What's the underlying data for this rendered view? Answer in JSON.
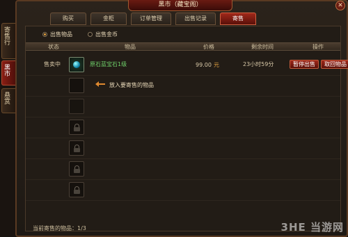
{
  "window": {
    "title": "黑市（藏宝阁）",
    "close_label": "✕"
  },
  "side_tabs": [
    {
      "label": "寄售行",
      "active": false
    },
    {
      "label": "黑市",
      "active": true
    },
    {
      "label": "悬赏",
      "active": false
    }
  ],
  "tabs": [
    {
      "label": "购买",
      "active": false
    },
    {
      "label": "金柜",
      "active": false
    },
    {
      "label": "订单管理",
      "active": false
    },
    {
      "label": "出售记录",
      "active": false
    },
    {
      "label": "寄售",
      "active": true
    }
  ],
  "sell_type": {
    "options": [
      {
        "label": "出售物品",
        "selected": true
      },
      {
        "label": "出售金币",
        "selected": false
      }
    ]
  },
  "table": {
    "headers": [
      "状态",
      "物品",
      "价格",
      "剩余时间",
      "操作"
    ],
    "listed_row": {
      "status": "售卖中",
      "item_name": "原石蓝宝石1级",
      "price": "99.00",
      "currency": "元",
      "remaining": "23小时59分",
      "pause_label": "暂停出售",
      "cancel_label": "取回物品"
    },
    "empty_slot_hint": "放入要寄售的物品",
    "locked_slots": 5
  },
  "footer": {
    "text": "当前寄售的物品：1/3"
  },
  "watermark": "3HE 当游网",
  "colors": {
    "accent": "#a0281a",
    "item_name": "#6fd06a",
    "currency": "#e0a040"
  }
}
